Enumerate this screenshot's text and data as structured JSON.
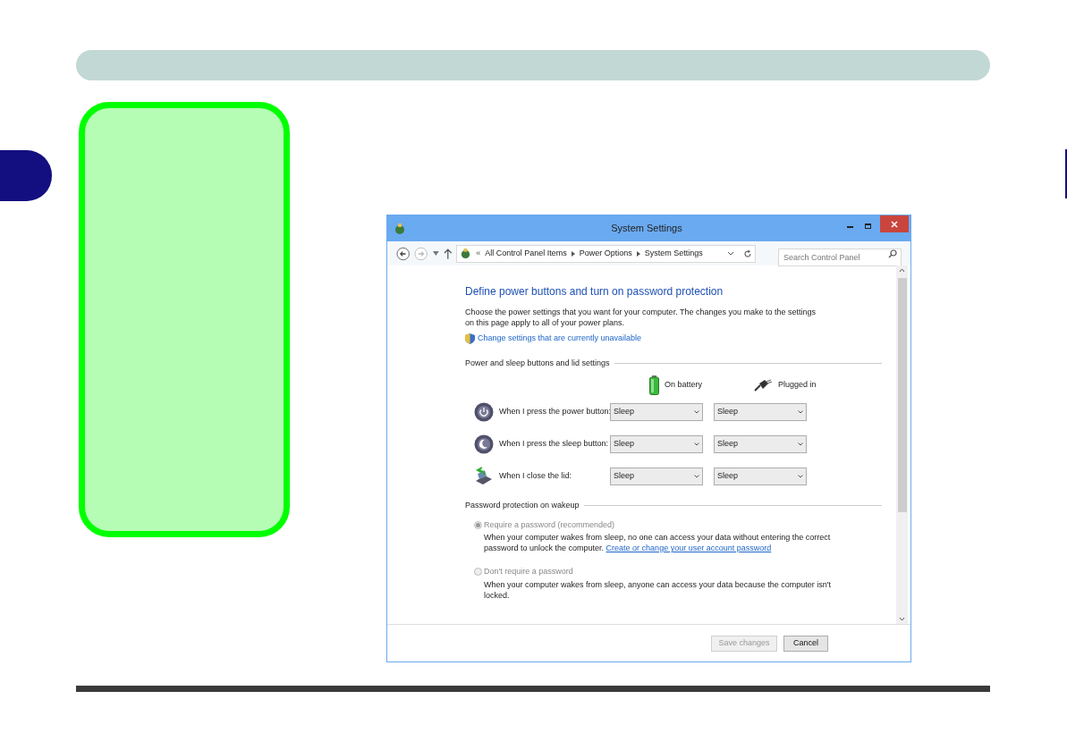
{
  "window": {
    "title": "System Settings"
  },
  "address_bar": {
    "prefix": "«",
    "crumbs": [
      "All Control Panel Items",
      "Power Options",
      "System Settings"
    ]
  },
  "search": {
    "placeholder": "Search Control Panel"
  },
  "heading": "Define power buttons and turn on password protection",
  "description": "Choose the power settings that you want for your computer. The changes you make to the settings on this page apply to all of your power plans.",
  "shield_link": "Change settings that are currently unavailable",
  "power_section": {
    "title": "Power and sleep buttons and lid settings",
    "columns": [
      {
        "kind": "battery",
        "label": "On battery"
      },
      {
        "kind": "plug",
        "label": "Plugged in"
      }
    ],
    "rows": [
      {
        "kind": "power",
        "label": "When I press the power button:",
        "values": [
          "Sleep",
          "Sleep"
        ]
      },
      {
        "kind": "sleep",
        "label": "When I press the sleep button:",
        "values": [
          "Sleep",
          "Sleep"
        ]
      },
      {
        "kind": "lid",
        "label": "When I close the lid:",
        "values": [
          "Sleep",
          "Sleep"
        ]
      }
    ]
  },
  "password_section": {
    "title": "Password protection on wakeup",
    "options": [
      {
        "label": "Require a password (recommended)",
        "selected": true,
        "disabled": true,
        "description": "When your computer wakes from sleep, no one can access your data without entering the correct password to unlock the computer.",
        "link": "Create or change your user account password"
      },
      {
        "label": "Don't require a password",
        "selected": false,
        "disabled": true,
        "description": "When your computer wakes from sleep, anyone can access your data because the computer isn't locked."
      }
    ]
  },
  "buttons": [
    {
      "label": "Save changes",
      "disabled": true
    },
    {
      "label": "Cancel",
      "disabled": false
    }
  ]
}
